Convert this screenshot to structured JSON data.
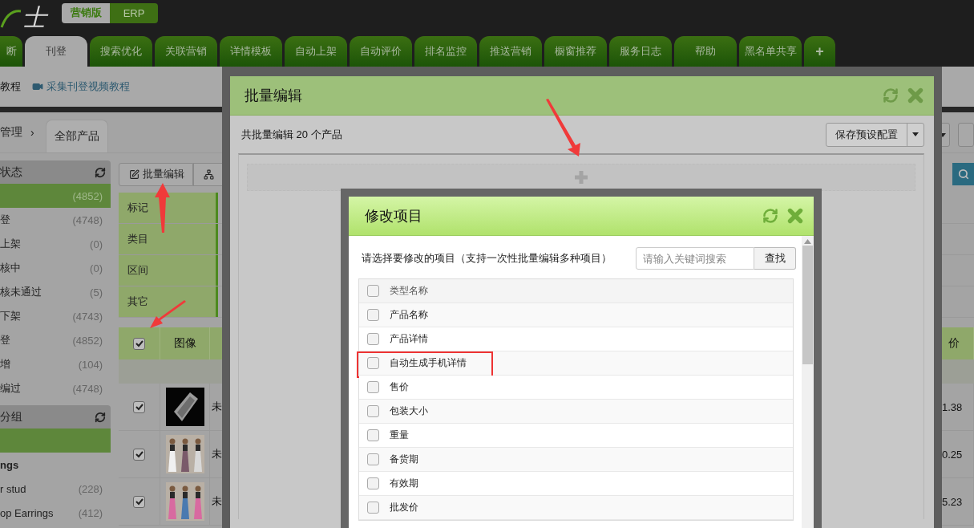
{
  "header": {
    "logo": "士",
    "editions": [
      {
        "label": "营销版",
        "selected": true
      },
      {
        "label": "ERP",
        "selected": false
      }
    ]
  },
  "nav_tabs": [
    {
      "label": "断",
      "selected": false
    },
    {
      "label": "刊登",
      "selected": true
    },
    {
      "label": "搜索优化",
      "selected": false
    },
    {
      "label": "关联营销",
      "selected": false
    },
    {
      "label": "详情模板",
      "selected": false
    },
    {
      "label": "自动上架",
      "selected": false
    },
    {
      "label": "自动评价",
      "selected": false
    },
    {
      "label": "排名监控",
      "selected": false
    },
    {
      "label": "推送营销",
      "selected": false
    },
    {
      "label": "橱窗推荐",
      "selected": false
    },
    {
      "label": "服务日志",
      "selected": false
    },
    {
      "label": "帮助",
      "selected": false
    },
    {
      "label": "黑名单共享",
      "selected": false
    },
    {
      "label": "+",
      "selected": false
    }
  ],
  "subbar": {
    "links": [
      {
        "label": "教程",
        "kind": "text"
      },
      {
        "label": "采集刊登视频教程",
        "kind": "video"
      }
    ]
  },
  "breadcrumb": {
    "parent": "管理",
    "separator": "›",
    "tab": "全部产品"
  },
  "sidebar": {
    "sections": [
      {
        "title": "状态",
        "items": [
          {
            "count": "(4852)",
            "selected": true,
            "bold": false
          },
          {
            "label": "登",
            "count": "(4748)",
            "selected": false,
            "bold": false
          },
          {
            "label": "上架",
            "count": "(0)",
            "selected": false,
            "bold": false
          },
          {
            "label": "核中",
            "count": "(0)",
            "selected": false,
            "bold": false
          },
          {
            "label": "核未通过",
            "count": "(5)",
            "selected": false,
            "bold": false
          },
          {
            "label": "下架",
            "count": "(4743)",
            "selected": false,
            "bold": false
          },
          {
            "label": "登",
            "count": "(4852)",
            "selected": false,
            "bold": false
          },
          {
            "label": "增",
            "count": "(104)",
            "selected": false,
            "bold": false
          },
          {
            "label": "编过",
            "count": "(4748)",
            "selected": false,
            "bold": false
          }
        ]
      },
      {
        "title": "分组",
        "items": [
          {
            "selected": true,
            "bold": false
          },
          {
            "label": "ngs",
            "selected": false,
            "bold": true
          },
          {
            "label": "r stud",
            "count": "(228)",
            "selected": false,
            "bold": false
          },
          {
            "label": "op Earrings",
            "count": "(412)",
            "selected": false,
            "bold": false
          }
        ]
      }
    ]
  },
  "toolbar": {
    "buttons": [
      {
        "label": "批量编辑",
        "kind": "edit"
      },
      {
        "kind": "tree"
      }
    ]
  },
  "filters": [
    "标记",
    "类目",
    "区间",
    "其它"
  ],
  "table": {
    "select_all_checked": true,
    "image_column": "图像",
    "price_column": "价",
    "rows": [
      {
        "checked": true,
        "status": "未",
        "price": "1.38"
      },
      {
        "checked": true,
        "status": "未",
        "price": "0.25"
      },
      {
        "checked": true,
        "status": "未",
        "price": "5.23"
      }
    ]
  },
  "batch_modal": {
    "title": "批量编辑",
    "summary": "共批量编辑 20 个产品",
    "save_button": "保存预设配置"
  },
  "item_dialog": {
    "title": "修改项目",
    "instruction": "请选择要修改的项目（支持一次性批量编辑多种项目）",
    "search": {
      "placeholder": "请输入关键词搜索"
    },
    "search_button": "查找",
    "header": {
      "label": "类型名称",
      "checked": false
    },
    "items": [
      {
        "label": "产品名称",
        "checked": false,
        "highlighted": false
      },
      {
        "label": "产品详情",
        "checked": false,
        "highlighted": false
      },
      {
        "label": "自动生成手机详情",
        "checked": false,
        "highlighted": true
      },
      {
        "label": "售价",
        "checked": false,
        "highlighted": false
      },
      {
        "label": "包装大小",
        "checked": false,
        "highlighted": false
      },
      {
        "label": "重量",
        "checked": false,
        "highlighted": false
      },
      {
        "label": "备货期",
        "checked": false,
        "highlighted": false
      },
      {
        "label": "有效期",
        "checked": false,
        "highlighted": false
      },
      {
        "label": "批发价",
        "checked": false,
        "highlighted": false
      }
    ]
  }
}
